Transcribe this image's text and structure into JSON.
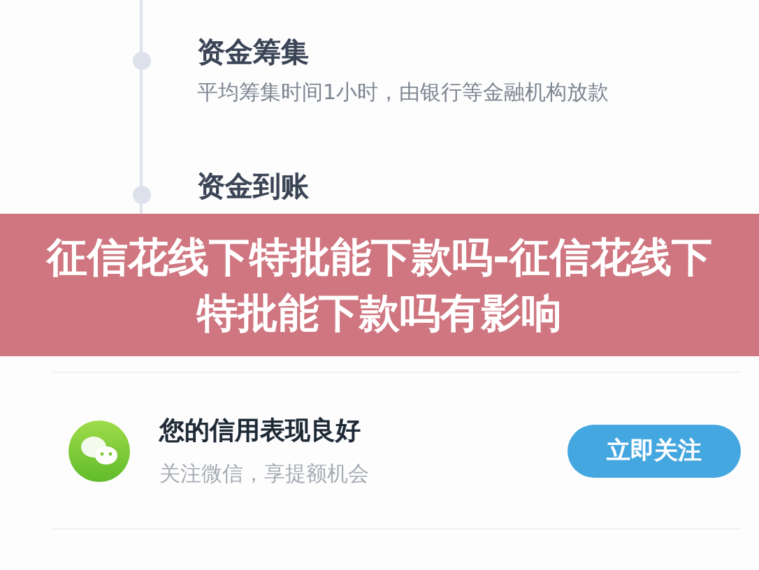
{
  "steps": [
    {
      "title": "资金筹集",
      "description": "平均筹集时间1小时，由银行等金融机构放款"
    },
    {
      "title": "资金到账"
    }
  ],
  "banner": {
    "text": "征信花线下特批能下款吗-征信花线下特批能下款吗有影响"
  },
  "follow_card": {
    "title": "您的信用表现良好",
    "subtitle": "关注微信，享提额机会",
    "button": "立即关注"
  }
}
